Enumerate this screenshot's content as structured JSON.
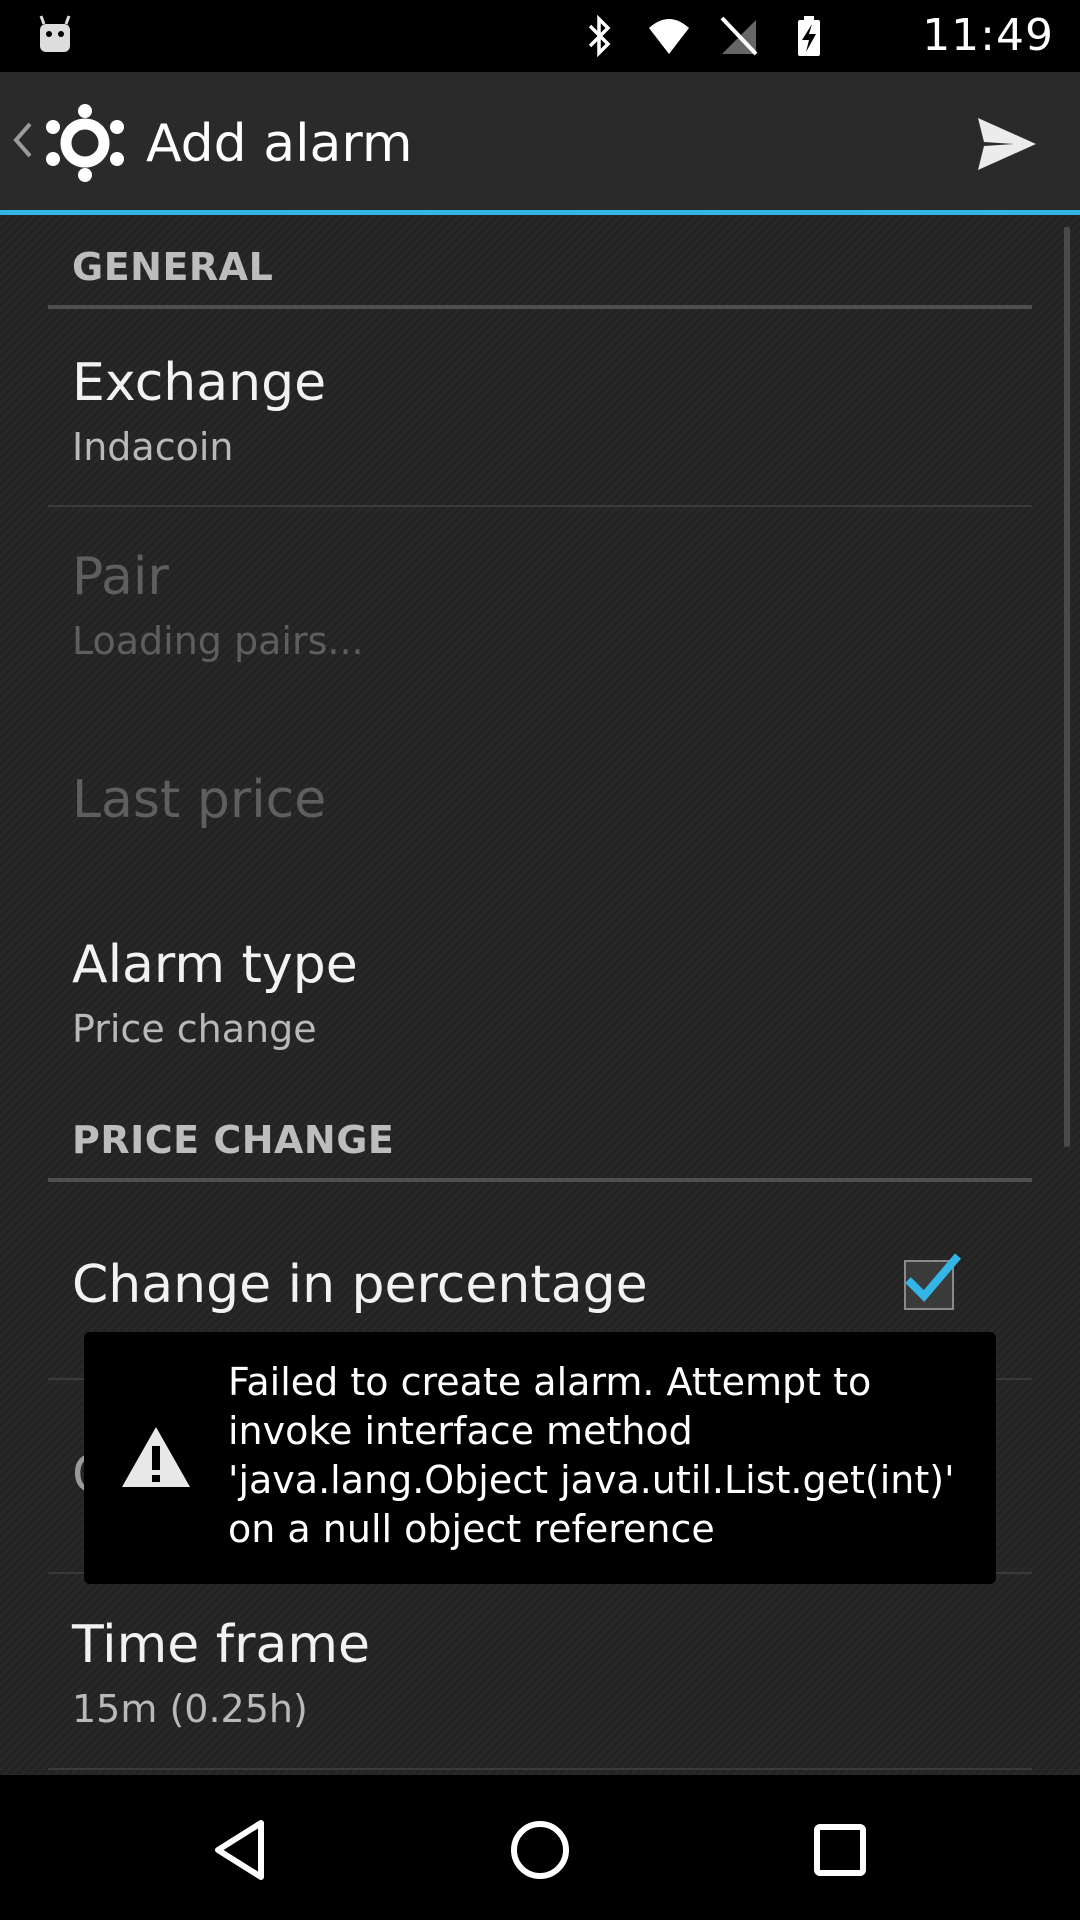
{
  "status_bar": {
    "time": "11:49",
    "icons": [
      "android-icon",
      "bluetooth-icon",
      "wifi-icon",
      "no-signal-icon",
      "battery-charging-icon"
    ]
  },
  "action_bar": {
    "title": "Add alarm",
    "up_icon": "chevron-left-icon",
    "logo_icon": "app-logo-icon",
    "send_icon": "send-icon",
    "accent_color": "#33b5e5"
  },
  "sections": {
    "general": {
      "header": "GENERAL",
      "exchange": {
        "title": "Exchange",
        "summary": "Indacoin"
      },
      "pair": {
        "title": "Pair",
        "summary": "Loading pairs...",
        "enabled": false
      },
      "last_price": {
        "title": "Last price",
        "enabled": false
      },
      "alarm_type": {
        "title": "Alarm type",
        "summary": "Price change"
      }
    },
    "price_change": {
      "header": "PRICE CHANGE",
      "change_in_percentage": {
        "title": "Change in percentage",
        "checked": true
      },
      "hidden_item_initial": "C",
      "time_frame": {
        "title": "Time frame",
        "summary": "15m (0.25h)"
      }
    }
  },
  "toast": {
    "icon": "warning-icon",
    "message": "Failed to create alarm. Attempt to invoke interface method 'java.lang.Object java.util.List.get(int)' on a null object reference"
  },
  "nav_bar": {
    "back_icon": "back-triangle-icon",
    "home_icon": "home-circle-icon",
    "recents_icon": "recents-square-icon"
  }
}
